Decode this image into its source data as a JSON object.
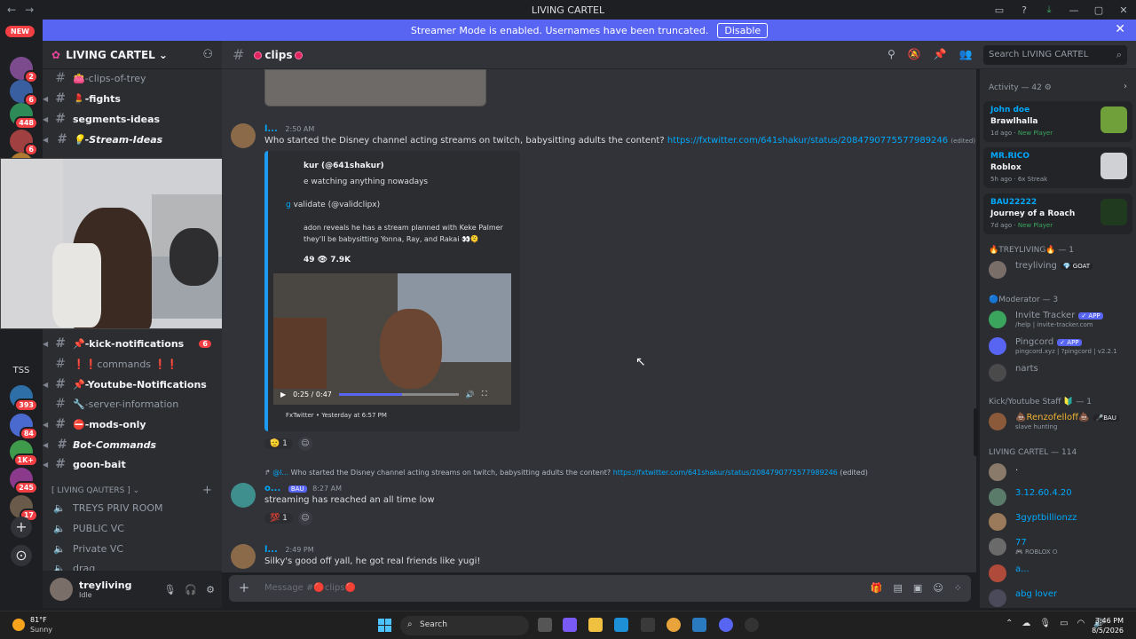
{
  "window": {
    "title": "LIVING CARTEL",
    "nav_back": "←",
    "nav_forward": "→",
    "controls": [
      "▭",
      "?",
      "⤓",
      "—",
      "▢",
      "✕"
    ]
  },
  "banner": {
    "text": "Streamer Mode is enabled. Usernames have been truncated.",
    "button": "Disable",
    "close": "✕"
  },
  "guilds": {
    "new_pill": "NEW",
    "badges": [
      "2",
      "6",
      "448",
      "6",
      "393",
      "84",
      "1K+",
      "245",
      "17"
    ],
    "tss": "TSS",
    "add": "+",
    "discover": "⊙"
  },
  "server": {
    "name": "LIVING CARTEL",
    "chevron": "⌄"
  },
  "channels": [
    {
      "name": "👛-clips-of-trey",
      "style": "muted"
    },
    {
      "name": "💄-fights",
      "style": "bold"
    },
    {
      "name": "segments-ideas",
      "style": "bold"
    },
    {
      "name": "💡-Stream-Ideas",
      "style": "bold-italic"
    },
    {
      "name": "📌-kick-notifications",
      "style": "bold",
      "badge": "6"
    },
    {
      "name": "❗❗commands ❗❗",
      "style": "muted"
    },
    {
      "name": "📌-Youtube-Notifications",
      "style": "bold"
    },
    {
      "name": "🔧-server-information",
      "style": "muted"
    },
    {
      "name": "⛔-mods-only",
      "style": "bold"
    },
    {
      "name": "Bot-Commands",
      "style": "italic"
    },
    {
      "name": "goon-bait",
      "style": "bold"
    }
  ],
  "voice_category": "[ LIVING QAUTERS ]",
  "voice_channels": [
    "TREYS PRIV ROOM",
    "PUBLIC VC",
    "Private VC",
    "drag"
  ],
  "user": {
    "name": "treyliving",
    "status": "Idle"
  },
  "chat": {
    "channel_name": "clips",
    "search_placeholder": "Search LIVING CARTEL",
    "composer_placeholder": "Message #🔴clips🔴"
  },
  "messages": [
    {
      "author": "l...",
      "time": "2:50 AM",
      "text": "Who started the Disney channel acting streams on twitch, babysitting adults the content? ",
      "link": "https://fxtwitter.com/641shakur/status/2084790775577989246",
      "edited": "(edited)"
    },
    {
      "author": "o...",
      "tag": "BAU",
      "time": "8:27 AM",
      "text": "streaming has reached an all time low",
      "reply_author": "@l...",
      "reply_text": "Who started the Disney channel acting streams on twitch, babysitting adults the content? ",
      "reply_link": "https://fxtwitter.com/641shakur/status/2084790775577989246",
      "reply_edited": "(edited)"
    },
    {
      "author": "l...",
      "time": "2:49 PM",
      "text": "Silky's good off yall, he got real friends like yugi!"
    }
  ],
  "embed": {
    "author": "kur (@641shakur)",
    "line1": "e watching anything nowadays",
    "quote_prefix": "g ",
    "quote_name": "validate (@validclipx)",
    "body": "adon reveals he has a stream planned with Keke Palmer they'll be babysitting Yonna, Ray, and Rakai 👀🫠",
    "stats": "49  👁 7.9K",
    "video_time": "0:25 / 0:47",
    "video_progress": 0.53,
    "footer": "FxTwitter • Yesterday at 6:57 PM"
  },
  "reactions": [
    {
      "emoji": "🫡",
      "count": "1"
    },
    {
      "emoji": "💯",
      "count": "1"
    }
  ],
  "members": {
    "activity_header": "Activity — 42 ⚙",
    "activities": [
      {
        "name": "John doe",
        "game": "Brawlhalla",
        "time": "1d ago",
        "note": "New Player"
      },
      {
        "name": "MR.RICO",
        "game": "Roblox",
        "time": "5h ago",
        "note": "6x Streak"
      },
      {
        "name": "BAU22222",
        "game": "Journey of a Roach",
        "time": "7d ago",
        "note": "New Player"
      }
    ],
    "groups": [
      {
        "title": "🔥TREYLIVING🔥 — 1",
        "members": [
          {
            "name": "treyliving",
            "tag": "💎 GOAT"
          }
        ]
      },
      {
        "title": "🔵Moderator — 3",
        "members": [
          {
            "name": "Invite Tracker",
            "tag": "✓ APP",
            "sub": "/help | invite-tracker.com"
          },
          {
            "name": "Pingcord",
            "tag": "✓ APP",
            "sub": "pingcord.xyz | ?pingcord | v2.2.1"
          },
          {
            "name": "narts"
          }
        ]
      },
      {
        "title": "Kick/Youtube Staff 🔰 — 1",
        "members": [
          {
            "name": "💩Renzofelloff💩",
            "tag": "🎤BAU",
            "sub": "slave hunting"
          }
        ]
      },
      {
        "title": "LIVING CARTEL — 114",
        "members": [
          {
            "name": "."
          },
          {
            "name": "3.12.60.4.20"
          },
          {
            "name": "3gyptbillionzz"
          },
          {
            "name": "77",
            "sub": "🎮 ROBLOX ⭘"
          },
          {
            "name": "a..."
          },
          {
            "name": "abg lover"
          }
        ]
      }
    ]
  },
  "taskbar": {
    "temp": "81°F",
    "condition": "Sunny",
    "search": "Search",
    "time": "3:46 PM",
    "date": "8/5/2026"
  },
  "colors": {
    "accent": "#5865f2",
    "link": "#00a8fc",
    "danger": "#f23f43",
    "online": "#3ba55d"
  }
}
